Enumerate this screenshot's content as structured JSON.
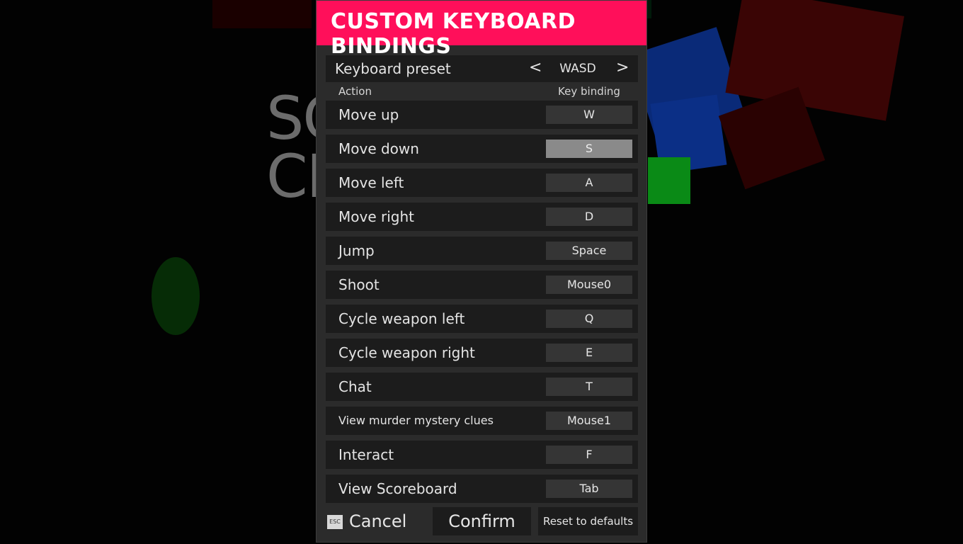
{
  "background": {
    "title_lines": [
      "SC",
      "CI"
    ]
  },
  "dialog": {
    "title": "CUSTOM KEYBOARD BINDINGS",
    "preset": {
      "label": "Keyboard preset",
      "prev": "<",
      "value": "WASD",
      "next": ">"
    },
    "columns": {
      "action": "Action",
      "key": "Key binding"
    },
    "bindings": [
      {
        "action": "Move up",
        "key": "W"
      },
      {
        "action": "Move down",
        "key": "S"
      },
      {
        "action": "Move left",
        "key": "A"
      },
      {
        "action": "Move right",
        "key": "D"
      },
      {
        "action": "Jump",
        "key": "Space"
      },
      {
        "action": "Shoot",
        "key": "Mouse0"
      },
      {
        "action": "Cycle weapon left",
        "key": "Q"
      },
      {
        "action": "Cycle weapon right",
        "key": "E"
      },
      {
        "action": "Chat",
        "key": "T"
      },
      {
        "action": "View murder mystery clues",
        "key": "Mouse1"
      },
      {
        "action": "Interact",
        "key": "F"
      },
      {
        "action": "View Scoreboard",
        "key": "Tab"
      }
    ],
    "footer": {
      "esc_badge": "ESC",
      "cancel": "Cancel",
      "confirm": "Confirm",
      "reset": "Reset to defaults"
    }
  },
  "colors": {
    "header": "#ff0f5a",
    "panel": "#2b2b2b",
    "row": "#1c1c1c",
    "key": "#353535",
    "key_selected": "#8a8a8a"
  }
}
